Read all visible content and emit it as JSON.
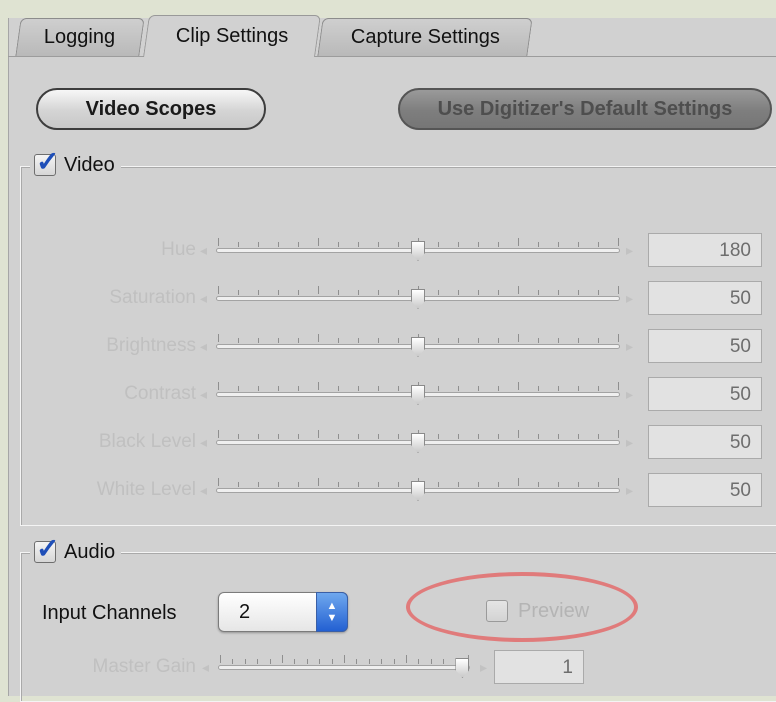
{
  "tabs": [
    {
      "label": "Logging",
      "active": false
    },
    {
      "label": "Clip Settings",
      "active": true
    },
    {
      "label": "Capture Settings",
      "active": false
    }
  ],
  "buttons": {
    "video_scopes": "Video Scopes",
    "use_defaults": "Use Digitizer's Default Settings"
  },
  "video": {
    "label": "Video",
    "checked": true,
    "sliders": [
      {
        "label": "Hue",
        "value": "180",
        "fraction": 0.5
      },
      {
        "label": "Saturation",
        "value": "50",
        "fraction": 0.5
      },
      {
        "label": "Brightness",
        "value": "50",
        "fraction": 0.5
      },
      {
        "label": "Contrast",
        "value": "50",
        "fraction": 0.5
      },
      {
        "label": "Black Level",
        "value": "50",
        "fraction": 0.5
      },
      {
        "label": "White Level",
        "value": "50",
        "fraction": 0.5
      }
    ]
  },
  "audio": {
    "label": "Audio",
    "checked": true,
    "input_channels_label": "Input Channels",
    "input_channels_value": "2",
    "preview_label": "Preview",
    "preview_checked": false,
    "master_gain": {
      "label": "Master Gain",
      "value": "1",
      "fraction": 0.97
    }
  },
  "colors": {
    "checkmark": "#1f4fb8",
    "highlight_ellipse": "#e07b7b",
    "stepper": "#2360d2"
  },
  "icons": [
    "checkmark-icon",
    "up-down-arrows-icon",
    "left-arrow-icon",
    "right-arrow-icon"
  ]
}
